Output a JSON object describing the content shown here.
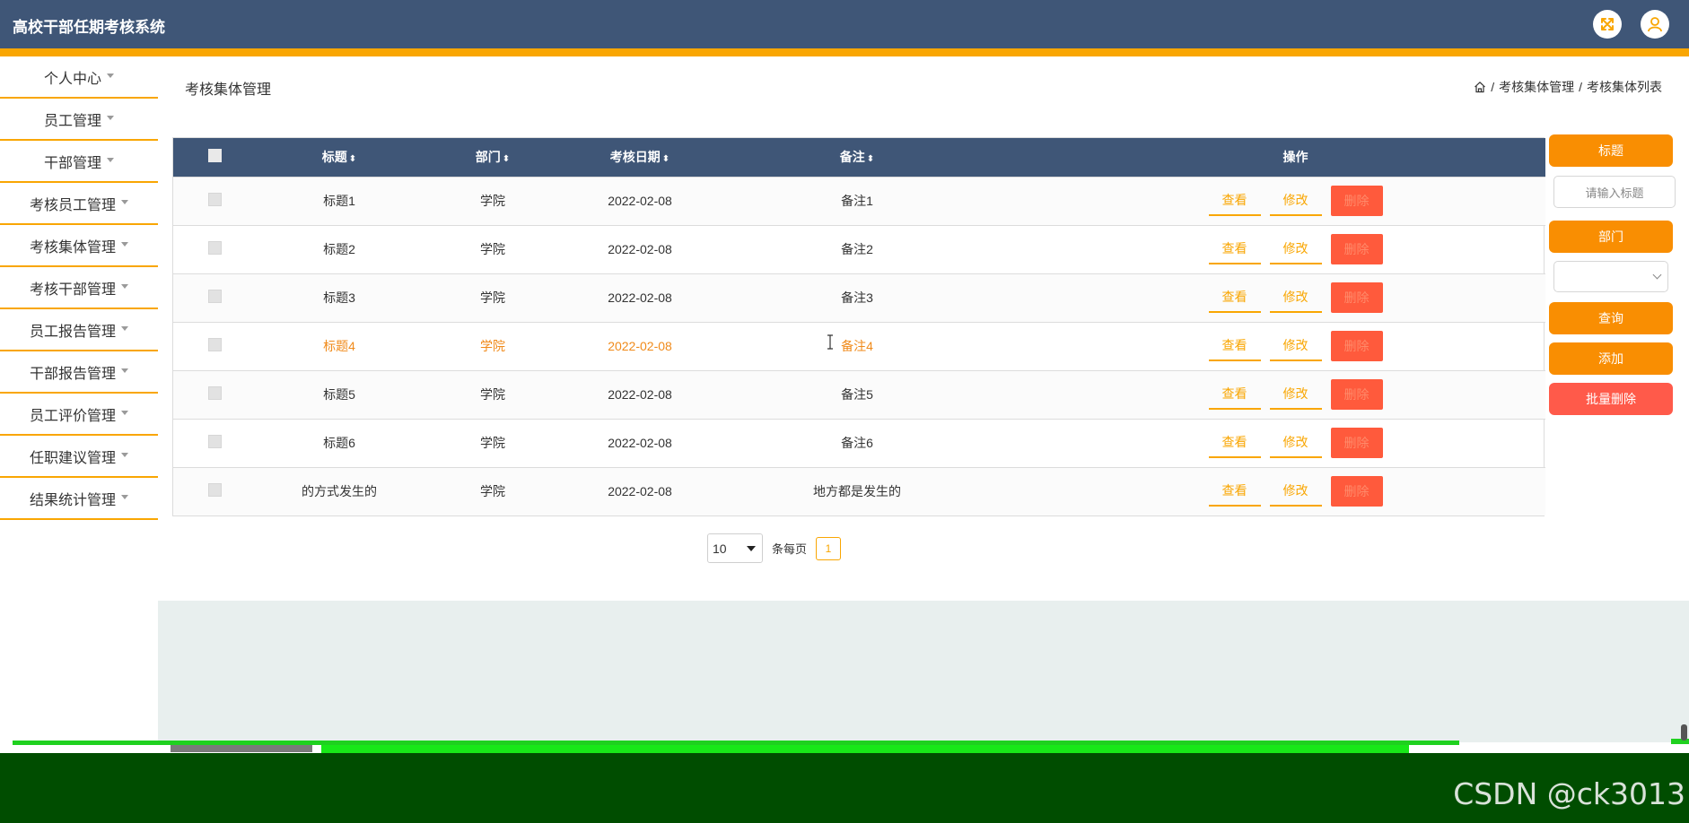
{
  "header": {
    "app_title": "高校干部任期考核系统",
    "accent_color": "#f9a602",
    "bar_color": "#3f5677",
    "icons": [
      "expand-icon",
      "user-icon"
    ]
  },
  "sidebar": {
    "items": [
      {
        "label": "个人中心"
      },
      {
        "label": "员工管理"
      },
      {
        "label": "干部管理"
      },
      {
        "label": "考核员工管理"
      },
      {
        "label": "考核集体管理"
      },
      {
        "label": "考核干部管理"
      },
      {
        "label": "员工报告管理"
      },
      {
        "label": "干部报告管理"
      },
      {
        "label": "员工评价管理"
      },
      {
        "label": "任职建议管理"
      },
      {
        "label": "结果统计管理"
      }
    ]
  },
  "page": {
    "title": "考核集体管理",
    "breadcrumb": [
      "考核集体管理",
      "考核集体列表"
    ],
    "breadcrumb_sep": "/"
  },
  "table": {
    "columns": {
      "title": "标题",
      "dept": "部门",
      "date": "考核日期",
      "note": "备注",
      "ops": "操作",
      "sort_glyph": "⬍"
    },
    "ops": {
      "view": "查看",
      "edit": "修改",
      "delete": "删除"
    },
    "rows": [
      {
        "title": "标题1",
        "dept": "学院",
        "date": "2022-02-08",
        "note": "备注1"
      },
      {
        "title": "标题2",
        "dept": "学院",
        "date": "2022-02-08",
        "note": "备注2"
      },
      {
        "title": "标题3",
        "dept": "学院",
        "date": "2022-02-08",
        "note": "备注3"
      },
      {
        "title": "标题4",
        "dept": "学院",
        "date": "2022-02-08",
        "note": "备注4"
      },
      {
        "title": "标题5",
        "dept": "学院",
        "date": "2022-02-08",
        "note": "备注5"
      },
      {
        "title": "标题6",
        "dept": "学院",
        "date": "2022-02-08",
        "note": "备注6"
      },
      {
        "title": "的方式发生的",
        "dept": "学院",
        "date": "2022-02-08",
        "note": "地方都是发生的"
      }
    ],
    "highlight_color": "#f08a1a"
  },
  "pager": {
    "page_size": "10",
    "per_page_label": "条每页",
    "current_page": "1"
  },
  "search": {
    "title_label": "标题",
    "title_placeholder": "请输入标题",
    "dept_label": "部门",
    "dept_value": "",
    "query_label": "查询",
    "add_label": "添加",
    "batch_delete_label": "批量删除"
  },
  "watermark": "CSDN @ck3013"
}
